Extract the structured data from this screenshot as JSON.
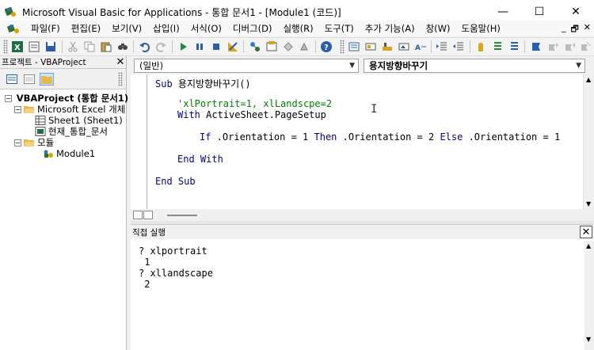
{
  "window": {
    "title": "Microsoft Visual Basic for Applications - 통합 문서1 - [Module1 (코드)]",
    "minimize": "—",
    "maximize": "☐",
    "close": "✕"
  },
  "menu": {
    "items": [
      "파일(F)",
      "편집(E)",
      "보기(V)",
      "삽입(I)",
      "서식(O)",
      "디버그(D)",
      "실행(R)",
      "도구(T)",
      "추가 기능(A)",
      "창(W)",
      "도움말(H)"
    ],
    "mdi_minimize": "_",
    "mdi_restore": "🗗",
    "mdi_close": "✕"
  },
  "toolbar": {
    "icons": [
      "excel-view-icon",
      "insert-module-icon",
      "save-icon",
      "cut-icon",
      "copy-icon",
      "paste-icon",
      "find-icon",
      "undo-icon",
      "redo-icon",
      "run-icon",
      "break-icon",
      "reset-icon",
      "design-mode-icon",
      "project-explorer-icon",
      "properties-icon",
      "object-browser-icon",
      "toolbox-icon",
      "help-icon"
    ]
  },
  "project_panel": {
    "title": "프로젝트 - VBAProject",
    "close": "✕",
    "tree": [
      {
        "level": 0,
        "expander": "⊟",
        "label": "VBAProject (통합 문서1)",
        "bold": true
      },
      {
        "level": 1,
        "expander": "⊟",
        "label": "Microsoft Excel 개체"
      },
      {
        "level": 2,
        "expander": "",
        "label": "Sheet1 (Sheet1)"
      },
      {
        "level": 2,
        "expander": "",
        "label": "현재_통합_문서"
      },
      {
        "level": 1,
        "expander": "⊟",
        "label": "모듈"
      },
      {
        "level": 2,
        "expander": "",
        "label": "Module1"
      }
    ]
  },
  "code_window": {
    "object_combo": "(일반)",
    "proc_combo": "용지방향바꾸기",
    "lines": [
      {
        "indent": 0,
        "parts": [
          {
            "t": "Sub",
            "c": "kw"
          },
          {
            "t": " 용지방향바꾸기()",
            "c": ""
          }
        ]
      },
      {
        "indent": 0,
        "parts": []
      },
      {
        "indent": 1,
        "parts": [
          {
            "t": "'xlPortrait=1, xlLandscpe=2",
            "c": "cm"
          }
        ]
      },
      {
        "indent": 1,
        "parts": [
          {
            "t": "With",
            "c": "kw"
          },
          {
            "t": " ActiveSheet.PageSetup",
            "c": ""
          }
        ]
      },
      {
        "indent": 0,
        "parts": []
      },
      {
        "indent": 2,
        "parts": [
          {
            "t": "If",
            "c": "kw"
          },
          {
            "t": " .Orientation = 1 ",
            "c": ""
          },
          {
            "t": "Then",
            "c": "kw"
          },
          {
            "t": " .Orientation = 2 ",
            "c": ""
          },
          {
            "t": "Else",
            "c": "kw"
          },
          {
            "t": " .Orientation = 1",
            "c": ""
          }
        ]
      },
      {
        "indent": 0,
        "parts": []
      },
      {
        "indent": 1,
        "parts": [
          {
            "t": "End With",
            "c": "kw"
          }
        ]
      },
      {
        "indent": 0,
        "parts": []
      },
      {
        "indent": 0,
        "parts": [
          {
            "t": "End Sub",
            "c": "kw"
          }
        ]
      }
    ]
  },
  "immediate_window": {
    "title": "직접 실행",
    "close": "✕",
    "lines": [
      "? xlportrait",
      " 1",
      "? xllandscape",
      " 2"
    ]
  },
  "colors": {
    "keyword": "#00008b",
    "comment": "#008000"
  }
}
